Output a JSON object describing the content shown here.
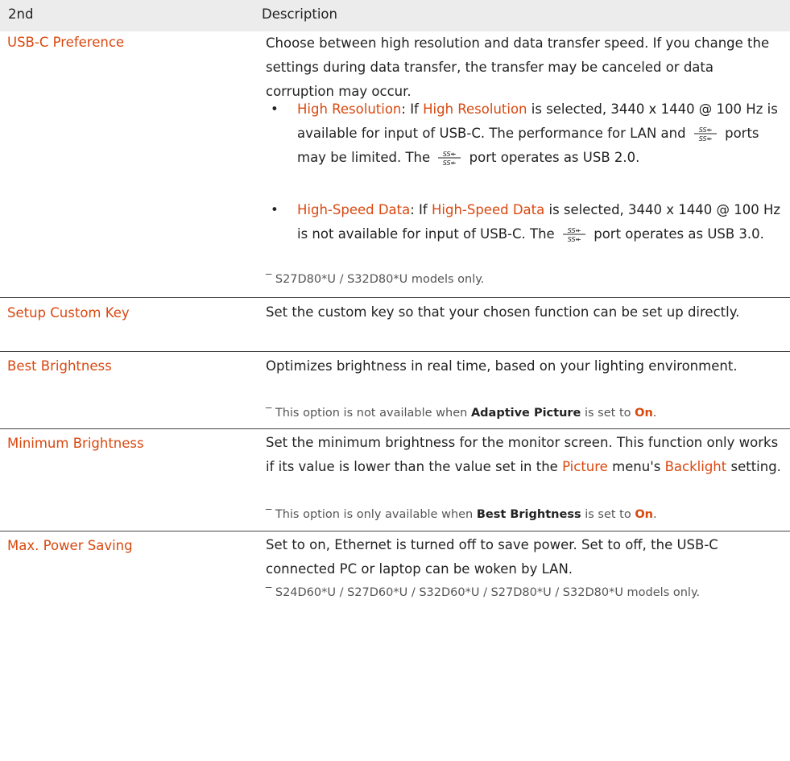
{
  "table": {
    "col1_header": "2nd",
    "col2_header": "Description"
  },
  "rows": {
    "usbc": {
      "name": "USB-C Preference",
      "intro": "Choose between high resolution and data transfer speed. If you change the settings during data transfer, the transfer may be canceled or data corruption may occur.",
      "b1_title": "High Resolution",
      "b1_sep": ": If ",
      "b1_title2": "High Resolution",
      "b1_text": " is selected, 3440 x 1440 @ 100 Hz is available for input of USB-C. The performance for LAN and",
      "b1_text2": "ports may be limited. The",
      "b1_text3": "port operates as USB 2.0.",
      "b2_title": "High-Speed Data",
      "b2_sep": ": If ",
      "b2_title2": "High-Speed Data",
      "b2_text": " is selected, 3440 x 1440 @ 100 Hz is not available for input of USB-C. The",
      "b2_text2": "port operates as USB 3.0.",
      "note": "S27D80*U / S32D80*U models only."
    },
    "customkey": {
      "name": "Setup Custom Key",
      "desc": "Set the custom key so that your chosen function can be set up directly."
    },
    "bestbright": {
      "name": "Best Brightness",
      "desc": "Optimizes brightness in real time, based on your lighting environment.",
      "note_pre": "This option is not available when ",
      "note_b1": "Adaptive Picture",
      "note_mid": " is set to ",
      "note_b2": "On",
      "note_end": "."
    },
    "minbright": {
      "name": "Minimum Brightness",
      "desc_pre": "Set the minimum brightness for the monitor screen. This function only works if its value is lower than the value set in the ",
      "desc_b1": "Picture",
      "desc_mid": " menu's ",
      "desc_b2": "Backlight",
      "desc_end": " setting.",
      "note_pre": "This option is only available when ",
      "note_b1": "Best Brightness",
      "note_mid": " is set to ",
      "note_b2": "On",
      "note_end": "."
    },
    "maxpower": {
      "name": "Max. Power Saving",
      "desc": "Set to on, Ethernet is turned off to save power. Set to off, the USB-C connected PC or laptop can be woken by LAN.",
      "note": "S24D60*U / S27D60*U / S32D60*U / S27D80*U / S32D80*U models only."
    }
  },
  "symbols": {
    "bullet": "•",
    "note_mark": "‾",
    "usb_icon": "usb-superspeed-icon"
  },
  "colors": {
    "accent": "#d9480f",
    "header_bg": "#ececec",
    "text": "#222222"
  }
}
